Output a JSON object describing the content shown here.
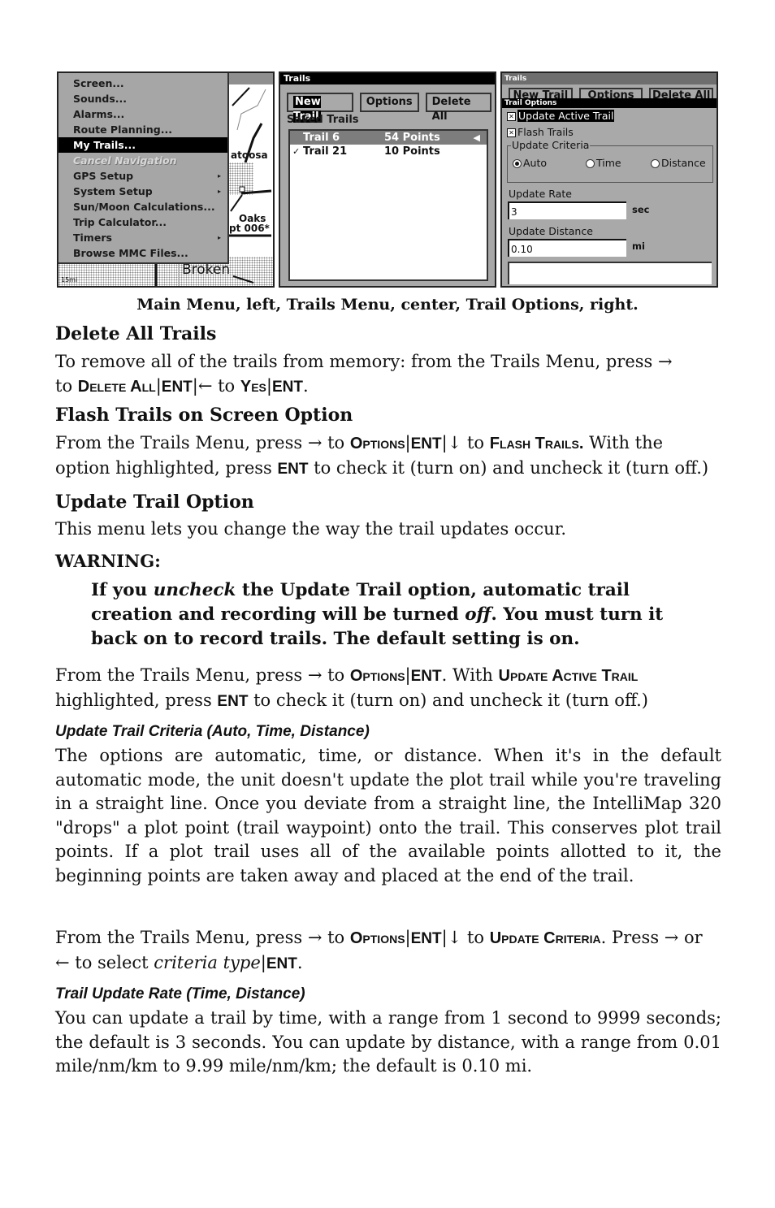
{
  "screenshots": {
    "main_menu": {
      "items": [
        {
          "label": "Screen...",
          "state": "normal",
          "submenu": false
        },
        {
          "label": "Sounds...",
          "state": "normal",
          "submenu": false
        },
        {
          "label": "Alarms...",
          "state": "normal",
          "submenu": false
        },
        {
          "label": "Route Planning...",
          "state": "normal",
          "submenu": false
        },
        {
          "label": "My Trails...",
          "state": "selected",
          "submenu": false
        },
        {
          "label": "Cancel Navigation",
          "state": "disabled",
          "submenu": false
        },
        {
          "label": "GPS Setup",
          "state": "normal",
          "submenu": true
        },
        {
          "label": "System Setup",
          "state": "normal",
          "submenu": true
        },
        {
          "label": "Sun/Moon Calculations...",
          "state": "normal",
          "submenu": false
        },
        {
          "label": "Trip Calculator...",
          "state": "normal",
          "submenu": false
        },
        {
          "label": "Timers",
          "state": "normal",
          "submenu": true
        },
        {
          "label": "Browse MMC Files...",
          "state": "normal",
          "submenu": false
        }
      ],
      "submenu_arrow": "▸",
      "map_labels": {
        "town1": "atoosa",
        "town2": "Oaks",
        "waypoint": "pt 006*",
        "town3": "Broken",
        "scale": "15mi"
      }
    },
    "trails_menu": {
      "title": "Trails",
      "buttons": {
        "new_trail": "New Trail",
        "options": "Options",
        "delete_all": "Delete All"
      },
      "saved_label": "Saved Trails",
      "trails": [
        {
          "name": "Trail 6",
          "points": "54 Points",
          "checked": false,
          "selected": true
        },
        {
          "name": "Trail 21",
          "points": "10 Points",
          "checked": true,
          "selected": false
        }
      ],
      "check_glyph": "✓",
      "pointer_glyph": "◀"
    },
    "trail_options": {
      "behind_title": "Trails",
      "behind_buttons": [
        "New Trail",
        "Options",
        "Delete All"
      ],
      "title": "Trail Options",
      "checkboxes": [
        {
          "label": "Update Active Trail",
          "checked": true,
          "selected": true
        },
        {
          "label": "Flash Trails",
          "checked": true,
          "selected": false
        }
      ],
      "checkbox_glyph": "✕",
      "criteria_legend": "Update Criteria",
      "criteria_options": [
        {
          "label": "Auto",
          "selected": true
        },
        {
          "label": "Time",
          "selected": false
        },
        {
          "label": "Distance",
          "selected": false
        }
      ],
      "update_rate": {
        "label": "Update Rate",
        "value": "3",
        "unit": "sec"
      },
      "update_distance": {
        "label": "Update Distance",
        "value": "0.10",
        "unit": "mi"
      }
    }
  },
  "caption": "Main Menu, left, Trails Menu, center, Trail Options, right.",
  "sections": {
    "delete_all": {
      "heading": "Delete All Trails",
      "line1": "To remove all of the trails from memory: from the Trails Menu, press →",
      "line2": {
        "to1": "to ",
        "cmd1": "Delete All",
        "sep1": "|",
        "key1": "ENT",
        "sep2": "|",
        "arrow": "← to ",
        "cmd2": "Yes",
        "sep3": "|",
        "key2": "ENT",
        "end": "."
      }
    },
    "flash": {
      "heading": "Flash Trails on Screen Option",
      "t1": "From the Trails Menu, press → to ",
      "cmd1": "Options",
      "sep1": "|",
      "key1": "ENT",
      "sep2": "|",
      "t2": "↓ to ",
      "cmd2": "Flash Trails.",
      "t3": " With the option highlighted, press ",
      "key2": "ENT",
      "t4": " to check it (turn on) and uncheck it (turn off.)"
    },
    "update_trail": {
      "heading": "Update Trail Option",
      "body": "This menu lets you change the way the trail updates occur."
    },
    "warning": {
      "heading": "WARNING:",
      "t1": "If you ",
      "em1": "uncheck",
      "t2": " the Update Trail option, automatic trail creation and recording will be turned ",
      "em2": "off",
      "t3": ". You must turn it back on to record trails. The default setting is on."
    },
    "update_active": {
      "t1": "From the Trails Menu, press → to ",
      "cmd1": "Options",
      "sep1": "|",
      "key1": "ENT",
      "t2": ". With ",
      "cmd2": "Update Active Trail",
      "t3": " highlighted, press ",
      "key2": "ENT",
      "t4": " to check it (turn on) and uncheck it (turn off.)"
    },
    "criteria": {
      "heading": "Update Trail Criteria (Auto, Time, Distance)",
      "body": "The options are automatic, time, or distance. When it's in the default automatic mode, the unit doesn't update the plot trail while you're traveling in a straight line. Once you deviate from a straight line, the IntelliMap 320 \"drops\" a plot point (trail waypoint) onto the trail. This conserves plot trail points. If a plot trail uses all of the available points allotted to it, the beginning points are taken away and placed at the end of the trail.",
      "instr": {
        "t1": "From the Trails Menu, press → to ",
        "cmd1": "Options",
        "sep1": "|",
        "key1": "ENT",
        "sep2": "|",
        "t2": "↓ to ",
        "cmd2": "Update Criteria",
        "t3": ". Press → or ← to select ",
        "em": "criteria type",
        "sep3": "|",
        "key2": "ENT",
        "end": "."
      }
    },
    "rate": {
      "heading": "Trail Update Rate (Time, Distance)",
      "body": "You can update a trail by time, with a range from 1 second to 9999 seconds; the default is 3 seconds. You can update by distance, with a range from 0.01 mile/nm/km to 9.99 mile/nm/km; the default is 0.10 mi."
    }
  }
}
